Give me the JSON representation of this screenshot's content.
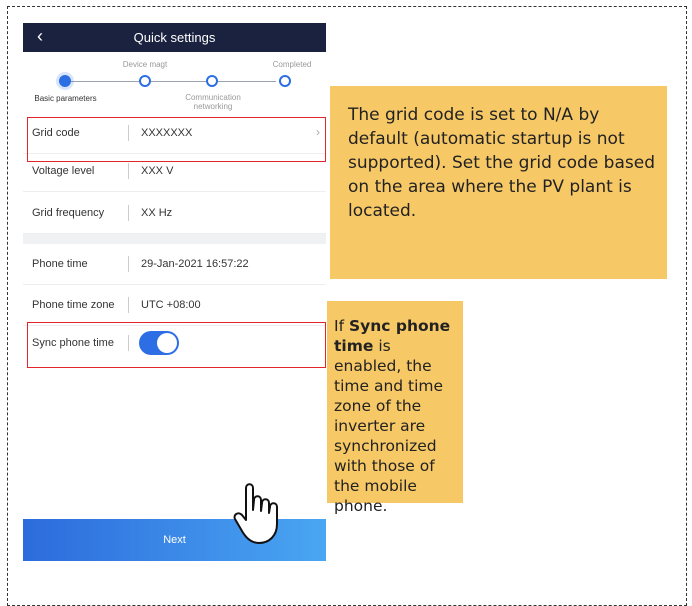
{
  "header": {
    "title": "Quick settings"
  },
  "steps": {
    "step1": "Basic parameters",
    "step2": "Device magt",
    "step3": "Communication networking",
    "step4": "Completed"
  },
  "rows": {
    "grid_code": {
      "label": "Grid code",
      "value": "XXXXXXX"
    },
    "voltage": {
      "label": "Voltage level",
      "value": "XXX V"
    },
    "frequency": {
      "label": "Grid frequency",
      "value": "XX Hz"
    },
    "phone_time": {
      "label": "Phone time",
      "value": "29-Jan-2021 16:57:22"
    },
    "time_zone": {
      "label": "Phone time zone",
      "value": "UTC +08:00"
    },
    "sync": {
      "label": "Sync phone time",
      "enabled": true
    }
  },
  "footer": {
    "next_label": "Next"
  },
  "callouts": {
    "grid_note": "The grid code is set to N/A by default (automatic startup is not supported). Set the grid code based on the area where the PV plant is located.",
    "sync_prefix": "If ",
    "sync_bold": "Sync phone time",
    "sync_suffix": " is enabled, the time and time zone of the inverter are synchronized with those of the mobile phone."
  },
  "colors": {
    "accent": "#2d6ee5",
    "title_bar": "#1b2240",
    "highlight": "#e0262a",
    "note_bg": "#f7c866"
  },
  "icons": {
    "back": "chevron-left-icon",
    "chevron": "chevron-right-icon",
    "pointer": "hand-pointer-icon"
  }
}
